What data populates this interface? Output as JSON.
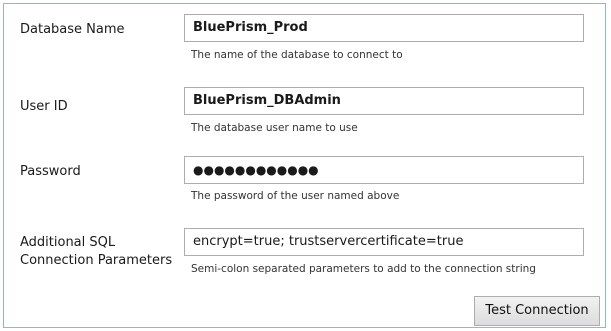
{
  "database_name": {
    "label": "Database Name",
    "value": "BluePrism_Prod",
    "hint": "The name of the database to connect to"
  },
  "user_id": {
    "label": "User ID",
    "value": "BluePrism_DBAdmin",
    "hint": "The database user name to use"
  },
  "password": {
    "label": "Password",
    "value": "●●●●●●●●●●●●",
    "hint": "The password of the user named above"
  },
  "additional_params": {
    "label_line1": "Additional SQL",
    "label_line2": "Connection Parameters",
    "value": "encrypt=true; trustservercertificate=true",
    "hint": "Semi-colon separated parameters to add to the connection string"
  },
  "test_button": {
    "label": "Test Connection"
  }
}
